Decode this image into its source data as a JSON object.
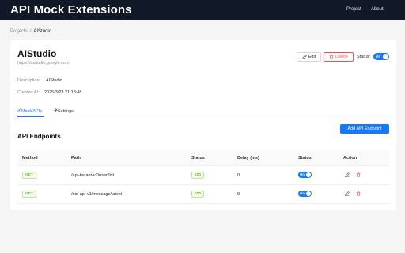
{
  "app": {
    "title": "API Mock Extensions",
    "nav": [
      "Project",
      "About"
    ]
  },
  "breadcrumb": [
    "Projects",
    "/",
    "AIStudio"
  ],
  "project": {
    "name": "AIStudio",
    "url": "https://aistudio.google.com",
    "edit_label": "Edit",
    "delete_label": "Delete",
    "status_label": "Status:",
    "status_toggle": "On",
    "description_label": "Description:",
    "description_value": "AIStudio",
    "created_label": "Created At:",
    "created_value": "2025/3/23 21:18:48"
  },
  "tabs": [
    {
      "label": "Mock APIs",
      "icon": "link-icon",
      "active": true
    },
    {
      "label": "Settings",
      "icon": "gear-icon",
      "active": false
    }
  ],
  "endpoints": {
    "title": "API Endpoints",
    "add_label": "Add API Endpoint",
    "columns": [
      "Method",
      "Path",
      "Status",
      "Delay (ms)",
      "Status",
      "Action"
    ],
    "rows": [
      {
        "method": "GET",
        "path": "/api-tenant-v2/user/list",
        "status": "200",
        "delay": "0",
        "toggle": "On"
      },
      {
        "method": "GET",
        "path": "/nio-api-v1/message/latest",
        "status": "200",
        "delay": "0",
        "toggle": "On"
      }
    ]
  },
  "colors": {
    "topbar": "#111827",
    "accent": "#1677ff",
    "danger": "#ff4d4f",
    "success": "#389e0d"
  }
}
